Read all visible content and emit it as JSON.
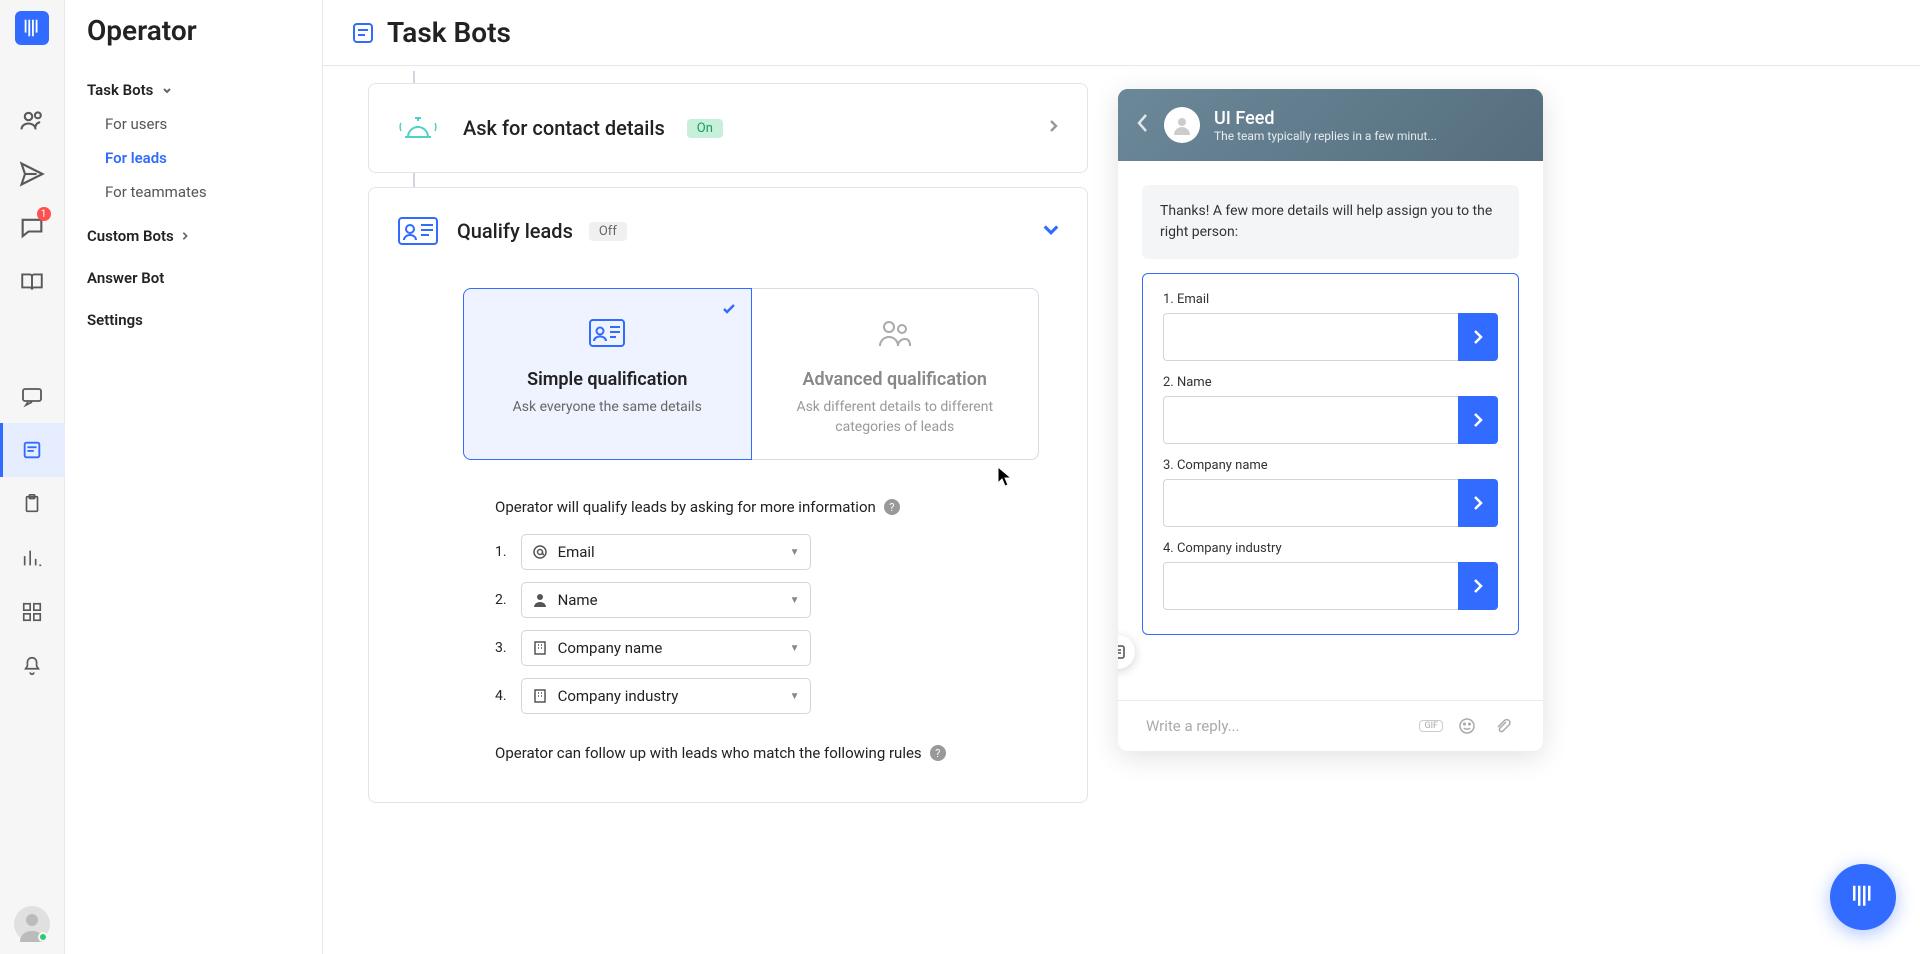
{
  "sidebar": {
    "app_name": "Operator",
    "task_bots": "Task Bots",
    "for_users": "For users",
    "for_leads": "For leads",
    "for_teammates": "For teammates",
    "custom_bots": "Custom Bots",
    "answer_bot": "Answer Bot",
    "settings": "Settings"
  },
  "rail": {
    "conversation_badge": "1"
  },
  "main": {
    "title": "Task Bots"
  },
  "card_contact": {
    "title": "Ask for contact details",
    "badge": "On"
  },
  "card_qualify": {
    "title": "Qualify leads",
    "badge": "Off",
    "simple_title": "Simple qualification",
    "simple_desc": "Ask everyone the same details",
    "advanced_title": "Advanced qualification",
    "advanced_desc": "Ask different details to different categories of leads",
    "qualify_text": "Operator will qualify leads by asking for more information",
    "follow_text": "Operator can follow up with leads who match the following rules"
  },
  "fields": [
    {
      "num": "1.",
      "label": "Email",
      "icon": "at"
    },
    {
      "num": "2.",
      "label": "Name",
      "icon": "user"
    },
    {
      "num": "3.",
      "label": "Company name",
      "icon": "building"
    },
    {
      "num": "4.",
      "label": "Company industry",
      "icon": "building"
    }
  ],
  "preview": {
    "title": "UI Feed",
    "subtitle": "The team typically replies in a few minut...",
    "intro": "Thanks! A few more details will help assign you to the right person:",
    "form": [
      "1. Email",
      "2. Name",
      "3. Company name",
      "4. Company industry"
    ],
    "reply_placeholder": "Write a reply...",
    "gif": "GIF"
  }
}
